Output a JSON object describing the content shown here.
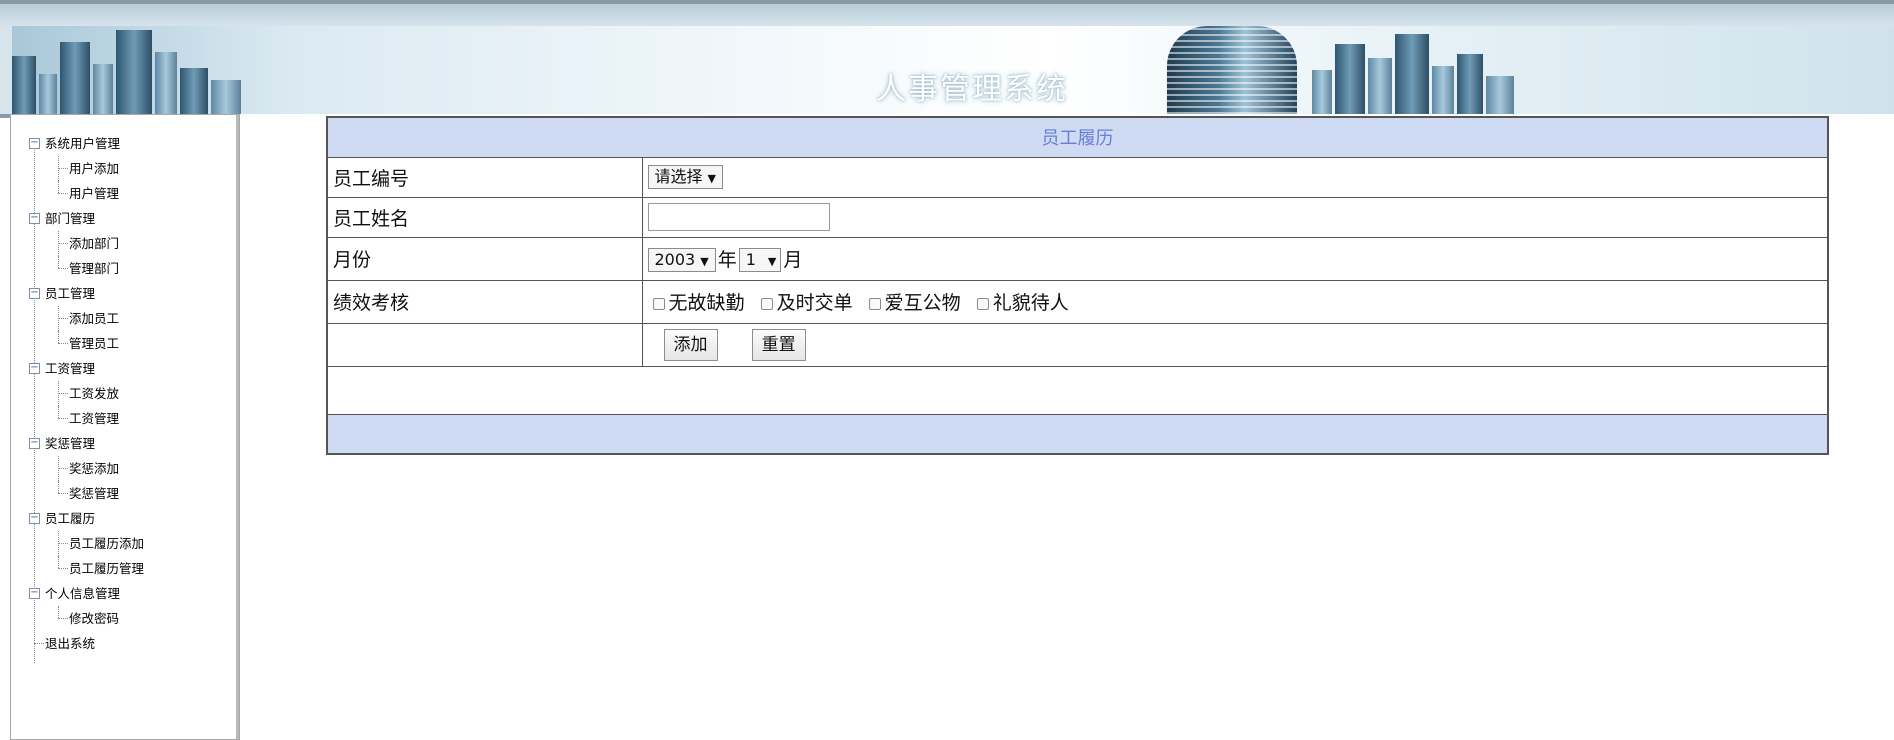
{
  "header": {
    "title": "人事管理系统"
  },
  "sidebar": {
    "groups": [
      {
        "label": "系统用户管理",
        "toggle": "−",
        "children": [
          "用户添加",
          "用户管理"
        ]
      },
      {
        "label": "部门管理",
        "toggle": "−",
        "children": [
          "添加部门",
          "管理部门"
        ]
      },
      {
        "label": "员工管理",
        "toggle": "−",
        "children": [
          "添加员工",
          "管理员工"
        ]
      },
      {
        "label": "工资管理",
        "toggle": "−",
        "children": [
          "工资发放",
          "工资管理"
        ]
      },
      {
        "label": "奖惩管理",
        "toggle": "−",
        "children": [
          "奖惩添加",
          "奖惩管理"
        ]
      },
      {
        "label": "员工履历",
        "toggle": "−",
        "children": [
          "员工履历添加",
          "员工履历管理"
        ]
      },
      {
        "label": "个人信息管理",
        "toggle": "−",
        "children": [
          "修改密码"
        ]
      }
    ],
    "logout": "退出系统"
  },
  "form": {
    "title": "员工履历",
    "employee_id": {
      "label": "员工编号",
      "selected": "请选择"
    },
    "employee_name": {
      "label": "员工姓名",
      "value": ""
    },
    "month": {
      "label": "月份",
      "year": "2003",
      "year_unit": "年",
      "month": "1",
      "month_unit": "月"
    },
    "performance": {
      "label": "绩效考核",
      "options": [
        "无故缺勤",
        "及时交单",
        "爱互公物",
        "礼貌待人"
      ]
    },
    "buttons": {
      "add": "添加",
      "reset": "重置"
    }
  },
  "icons": {
    "toggle": "minus-box-icon",
    "dropdown": "triangle-down-icon"
  },
  "colors": {
    "table_header_bg": "#cfdaf3",
    "table_header_text": "#6a7ed8",
    "border": "#555555"
  }
}
